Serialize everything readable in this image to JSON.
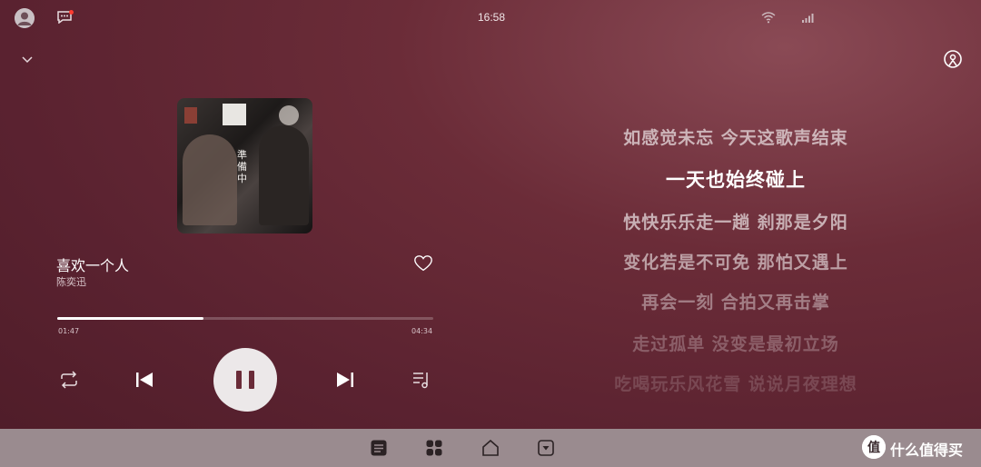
{
  "status_bar": {
    "time": "16:58",
    "icons": [
      "avatar",
      "message-icon",
      "wifi-icon",
      "signal-icon"
    ],
    "notification_dot_color": "#ff3b30"
  },
  "header": {
    "collapse_icon": "chevron-down-icon",
    "cast_icon": "cast-icon"
  },
  "album": {
    "cover_title": "準備中"
  },
  "song": {
    "title": "喜欢一个人",
    "artist": "陈奕迅",
    "liked": false
  },
  "playback": {
    "elapsed": "01:47",
    "total": "04:34",
    "progress": 0.39,
    "state": "playing",
    "controls": [
      "repeat-icon",
      "previous-icon",
      "pause-icon",
      "next-icon",
      "playlist-icon"
    ]
  },
  "lyrics": {
    "lines": [
      "如感觉未忘 今天这歌声结束",
      "一天也始终碰上",
      "快快乐乐走一趟 刹那是夕阳",
      "变化若是不可免 那怕又遇上",
      "再会一刻 合拍又再击掌",
      "走过孤单 没变是最初立场",
      "吃喝玩乐风花雪 说说月夜理想"
    ],
    "active_index": 1
  },
  "dock": {
    "items": [
      "list-icon",
      "apps-icon",
      "home-icon",
      "download-icon"
    ]
  },
  "watermark": {
    "text": "什么值得买",
    "logo_char": "值"
  },
  "colors": {
    "accent": "#6a2b38",
    "background": "#5a2230",
    "dock": "#9a8b8f"
  }
}
